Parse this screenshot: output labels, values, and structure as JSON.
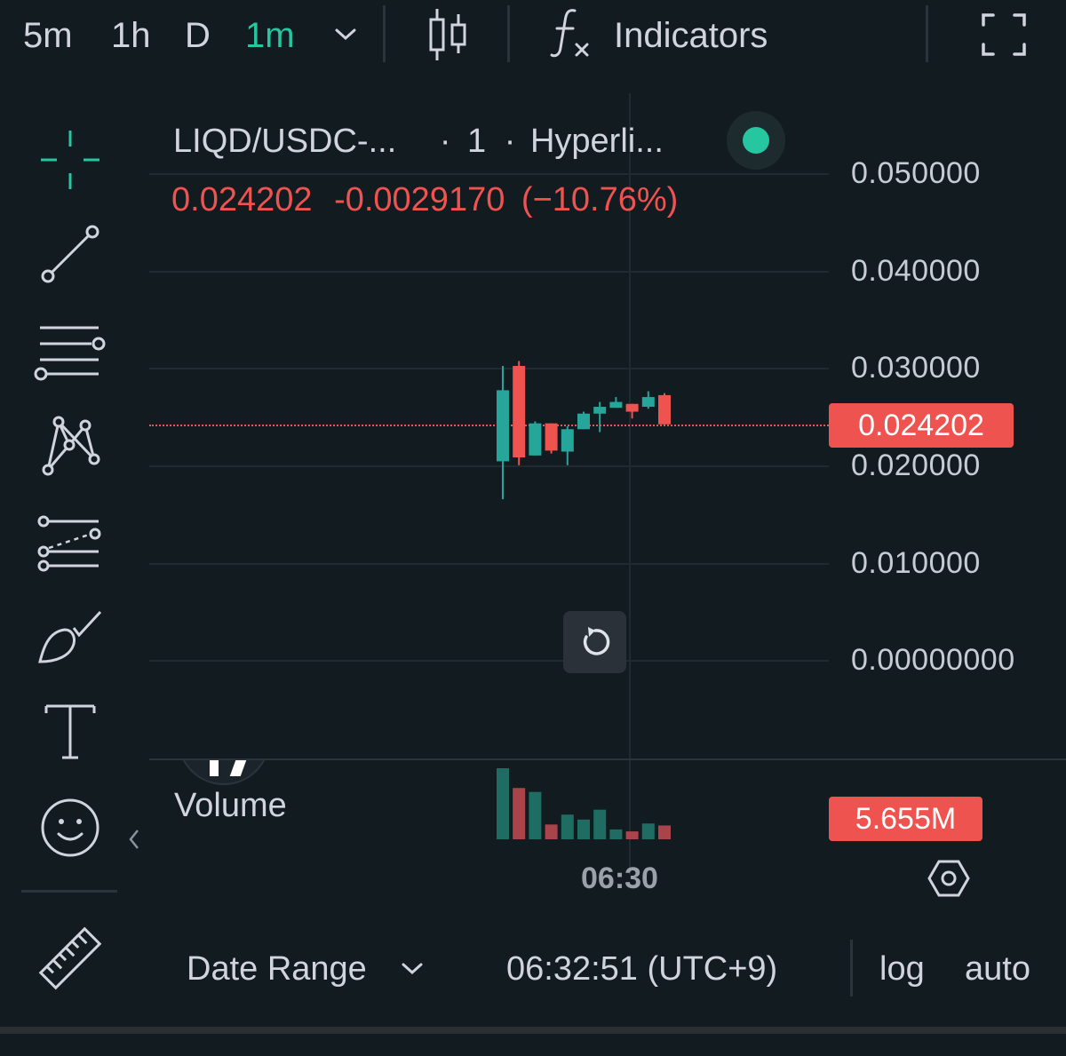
{
  "toolbar": {
    "timeframes": [
      "5m",
      "1h",
      "D",
      "1m"
    ],
    "active_timeframe": "1m",
    "indicators_label": "Indicators"
  },
  "legend": {
    "symbol": "LIQD/USDC-...",
    "interval": "1",
    "exchange": "Hyperli...",
    "price": "0.024202",
    "change": "-0.0029170",
    "change_pct": "(−10.76%)"
  },
  "price_axis": {
    "labels": [
      "0.050000",
      "0.040000",
      "0.030000",
      "0.020000",
      "0.010000",
      "0.00000000"
    ],
    "current_price": "0.024202"
  },
  "volume": {
    "label": "Volume",
    "value": "5.655M"
  },
  "time_axis": {
    "label": "06:30"
  },
  "bottom": {
    "date_range": "Date Range",
    "clock": "06:32:51 (UTC+9)",
    "log": "log",
    "auto": "auto"
  },
  "colors": {
    "up": "#26a69a",
    "down": "#ef5350",
    "accent": "#26c6a0",
    "background": "#121b20"
  },
  "chart_data": {
    "type": "candlestick",
    "ylim": [
      0,
      0.05
    ],
    "candles": [
      {
        "open": 0.0204,
        "high": 0.0302,
        "low": 0.0165,
        "close": 0.0277
      },
      {
        "open": 0.0302,
        "high": 0.0307,
        "low": 0.02,
        "close": 0.0208
      },
      {
        "open": 0.021,
        "high": 0.0245,
        "low": 0.021,
        "close": 0.0243
      },
      {
        "open": 0.0243,
        "high": 0.0243,
        "low": 0.0212,
        "close": 0.0215
      },
      {
        "open": 0.0214,
        "high": 0.024,
        "low": 0.02,
        "close": 0.0237
      },
      {
        "open": 0.0237,
        "high": 0.0255,
        "low": 0.0237,
        "close": 0.0253
      },
      {
        "open": 0.0253,
        "high": 0.0265,
        "low": 0.0234,
        "close": 0.026
      },
      {
        "open": 0.0259,
        "high": 0.027,
        "low": 0.0259,
        "close": 0.0265
      },
      {
        "open": 0.0263,
        "high": 0.0263,
        "low": 0.0248,
        "close": 0.0255
      },
      {
        "open": 0.026,
        "high": 0.0276,
        "low": 0.0258,
        "close": 0.027
      },
      {
        "open": 0.0272,
        "high": 0.0274,
        "low": 0.0242,
        "close": 0.0242
      }
    ],
    "volumes": [
      {
        "value": 72,
        "dir": "up"
      },
      {
        "value": 52,
        "dir": "down"
      },
      {
        "value": 48,
        "dir": "up"
      },
      {
        "value": 15,
        "dir": "down"
      },
      {
        "value": 25,
        "dir": "up"
      },
      {
        "value": 20,
        "dir": "up"
      },
      {
        "value": 30,
        "dir": "up"
      },
      {
        "value": 10,
        "dir": "up"
      },
      {
        "value": 8,
        "dir": "down"
      },
      {
        "value": 16,
        "dir": "up"
      },
      {
        "value": 14,
        "dir": "down"
      }
    ]
  }
}
